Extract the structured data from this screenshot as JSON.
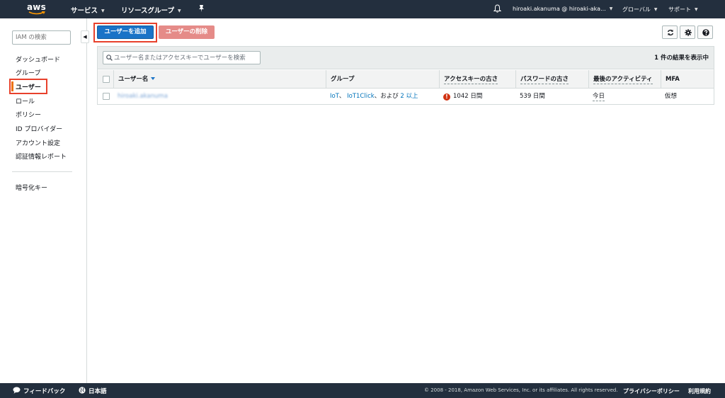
{
  "topnav": {
    "logo_text": "aws",
    "services": "サービス",
    "resource_groups": "リソースグループ",
    "account": "hiroaki.akanuma @ hiroaki-aka...",
    "region": "グローバル",
    "support": "サポート"
  },
  "sidebar": {
    "search_placeholder": "IAM の検索",
    "items": [
      {
        "label": "ダッシュボード"
      },
      {
        "label": "グループ"
      },
      {
        "label": "ユーザー"
      },
      {
        "label": "ロール"
      },
      {
        "label": "ポリシー"
      },
      {
        "label": "ID プロバイダー"
      },
      {
        "label": "アカウント設定"
      },
      {
        "label": "認証情報レポート"
      }
    ],
    "encryption_keys": "暗号化キー"
  },
  "toolbar": {
    "add_user": "ユーザーを追加",
    "delete_user": "ユーザーの削除"
  },
  "table": {
    "search_placeholder": "ユーザー名またはアクセスキーでユーザーを検索",
    "result_count": "1 件の結果を表示中",
    "columns": [
      "ユーザー名",
      "グループ",
      "アクセスキーの古さ",
      "パスワードの古さ",
      "最後のアクティビティ",
      "MFA"
    ],
    "rows": [
      {
        "username": "hiroaki.akanuma",
        "group_1": "IoT",
        "group_sep_1": "、",
        "group_2": "IoT1Click",
        "group_and": "、および",
        "group_more": "2 以上",
        "access_key_age": "1042 日間",
        "password_age": "539 日間",
        "last_activity": "今日",
        "mfa": "仮想"
      }
    ]
  },
  "footer": {
    "feedback": "フィードバック",
    "language": "日本語",
    "copyright": "© 2008 - 2018, Amazon Web Services, Inc. or its affiliates. All rights reserved.",
    "privacy": "プライバシーポリシー",
    "terms": "利用規約"
  },
  "colors": {
    "nav_bg": "#232f3e",
    "primary_button": "#1a73c7",
    "danger_button_disabled": "#e58b88",
    "highlight_box": "#e8412c",
    "active_marker": "#ec7211",
    "link": "#0073bb",
    "warning": "#d13212"
  }
}
